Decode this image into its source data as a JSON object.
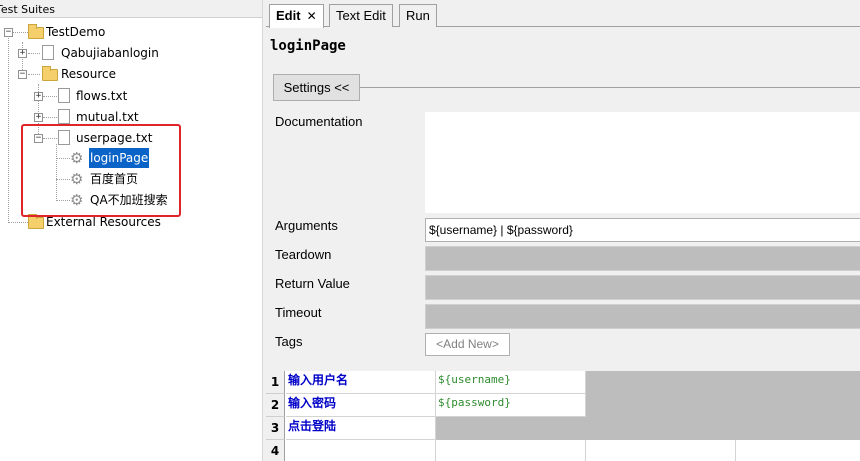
{
  "tree": {
    "header": "Test Suites",
    "items": [
      {
        "label": "TestDemo",
        "icon": "folder-icon"
      },
      {
        "label": "Qabujiabanlogin",
        "icon": "file-icon"
      },
      {
        "label": "Resource",
        "icon": "folder-icon"
      },
      {
        "label": "flows.txt",
        "icon": "resource-file-icon"
      },
      {
        "label": "mutual.txt",
        "icon": "resource-file-icon"
      },
      {
        "label": "userpage.txt",
        "icon": "resource-file-icon"
      },
      {
        "label": "loginPage",
        "icon": "gear-icon",
        "selected": true
      },
      {
        "label": "百度首页",
        "icon": "gear-icon"
      },
      {
        "label": "QA不加班搜索",
        "icon": "gear-icon"
      },
      {
        "label": "External Resources",
        "icon": "folder-icon"
      }
    ],
    "expander_collapsed": "+",
    "expander_expanded": "−"
  },
  "tabs": [
    {
      "label": "Edit",
      "active": true,
      "close": "✕"
    },
    {
      "label": "Text Edit",
      "active": false
    },
    {
      "label": "Run",
      "active": false
    }
  ],
  "editor": {
    "title": "loginPage",
    "settings_button": "Settings <<",
    "labels": {
      "documentation": "Documentation",
      "arguments": "Arguments",
      "teardown": "Teardown",
      "return_value": "Return Value",
      "timeout": "Timeout",
      "tags": "Tags"
    },
    "arguments_value": "${username} | ${password}",
    "tags_add": "<Add New>"
  },
  "grid": {
    "rows": [
      {
        "num": "1",
        "keyword": "输入用户名",
        "arg": "${username}"
      },
      {
        "num": "2",
        "keyword": "输入密码",
        "arg": "${password}"
      },
      {
        "num": "3",
        "keyword": "点击登陆",
        "arg": ""
      },
      {
        "num": "4",
        "keyword": "",
        "arg": ""
      }
    ]
  },
  "colors": {
    "selection": "#0a64c8",
    "highlight_box": "#e0242a",
    "keyword": "#0000c8",
    "argument": "#2e8b2e"
  }
}
